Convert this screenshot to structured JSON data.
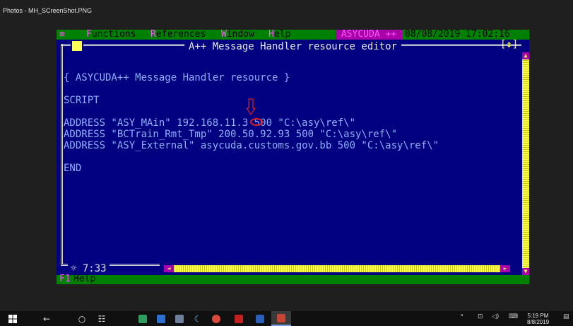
{
  "photos": {
    "title": "Photos - MH_SCreenShot.PNG"
  },
  "menu": {
    "system": "≡",
    "items": [
      {
        "hot": "F",
        "rest": "unctions"
      },
      {
        "hot": "R",
        "rest": "eferences"
      },
      {
        "hot": "W",
        "rest": "indow"
      },
      {
        "hot": "H",
        "rest": "elp"
      }
    ],
    "app": "ASYCUDA ++",
    "datetime": "08/08/2019 17:02:16"
  },
  "editor": {
    "title": "A++ Message Handler resource editor",
    "close_box": "[■]",
    "zoom_box": "[↕]",
    "lines": [
      "{ ASYCUDA++ Message Handler resource }",
      "",
      "SCRIPT",
      "",
      "ADDRESS \"ASY_MAin\" 192.168.11.3 500 \"C:\\asy\\ref\\\"",
      "ADDRESS \"BCTrain_Rmt_Tmp\" 200.50.92.93 500 \"C:\\asy\\ref\\\"",
      "ADDRESS \"ASY_External\" asycuda.customs.gov.bb 500 \"C:\\asy\\ref\\\"",
      "",
      "END"
    ],
    "cursor": "7:33",
    "cursor_marker": "☼"
  },
  "statusbar": {
    "key": "F1",
    "label": "Help"
  },
  "taskbar": {
    "time": "5:19 PM",
    "date": "8/8/2019"
  },
  "colors": {
    "editor_bg": "#000080",
    "menu_bg": "#008000",
    "text": "#8fb0ff",
    "annotation": "#e02020"
  }
}
